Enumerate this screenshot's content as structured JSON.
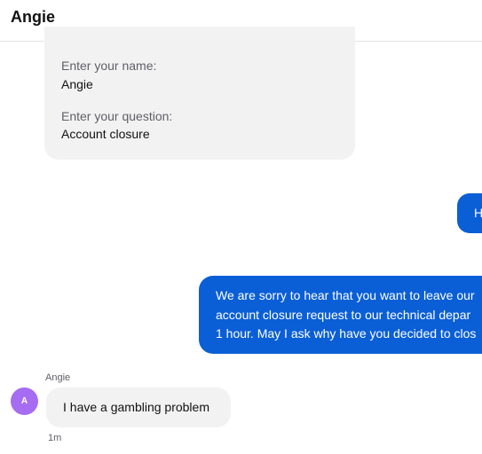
{
  "header": {
    "title": "Angie"
  },
  "form": {
    "name_label": "Enter your name:",
    "name_value": "Angie",
    "question_label": "Enter your question:",
    "question_value": "Account closure"
  },
  "messages": {
    "outgoing_short": "H",
    "outgoing_long": [
      "We are sorry to hear that you want to leave our",
      "account closure request to our technical depar",
      "1 hour. May I ask why have you decided to clos"
    ],
    "incoming": {
      "sender": "Angie",
      "avatar_letter": "A",
      "text": "I have a gambling problem",
      "time": "1m"
    }
  },
  "colors": {
    "outgoing_bubble": "#0a5fd7",
    "incoming_bubble": "#f2f2f3",
    "avatar": "#a66cf1"
  }
}
